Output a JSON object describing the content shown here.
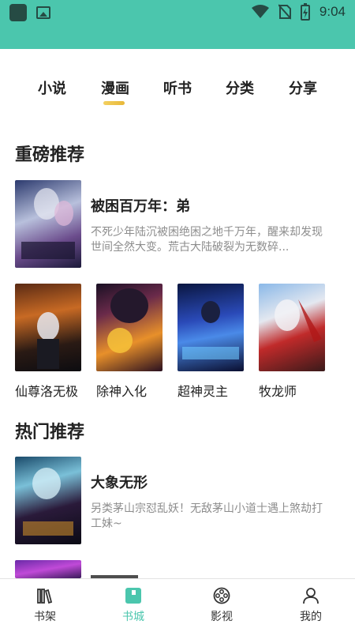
{
  "status_bar": {
    "time": "9:04"
  },
  "tabs": [
    {
      "label": "小说"
    },
    {
      "label": "漫画",
      "active": true
    },
    {
      "label": "听书"
    },
    {
      "label": "分类"
    },
    {
      "label": "分享"
    }
  ],
  "sections": {
    "featured": {
      "title": "重磅推荐",
      "main": {
        "title": "被困百万年：弟",
        "desc": "不死少年陆沉被困绝困之地千万年，醒来却发现世间全然大变。荒古大陆破裂为无数碎..."
      },
      "grid": [
        {
          "title": "仙尊洛无极"
        },
        {
          "title": "除神入化"
        },
        {
          "title": "超神灵主"
        },
        {
          "title": "牧龙师"
        }
      ]
    },
    "hot": {
      "title": "热门推荐",
      "items": [
        {
          "title": "大象无形",
          "desc": "另类茅山宗怼乱妖！无敌茅山小道士遇上煞劫打工妹~"
        }
      ]
    }
  },
  "bottom_nav": [
    {
      "label": "书架",
      "icon": "bookshelf-icon"
    },
    {
      "label": "书城",
      "icon": "bookstore-icon",
      "active": true
    },
    {
      "label": "影视",
      "icon": "film-reel-icon"
    },
    {
      "label": "我的",
      "icon": "person-icon"
    }
  ],
  "colors": {
    "accent": "#4bc6ad",
    "indicator": "#f0c84a"
  }
}
